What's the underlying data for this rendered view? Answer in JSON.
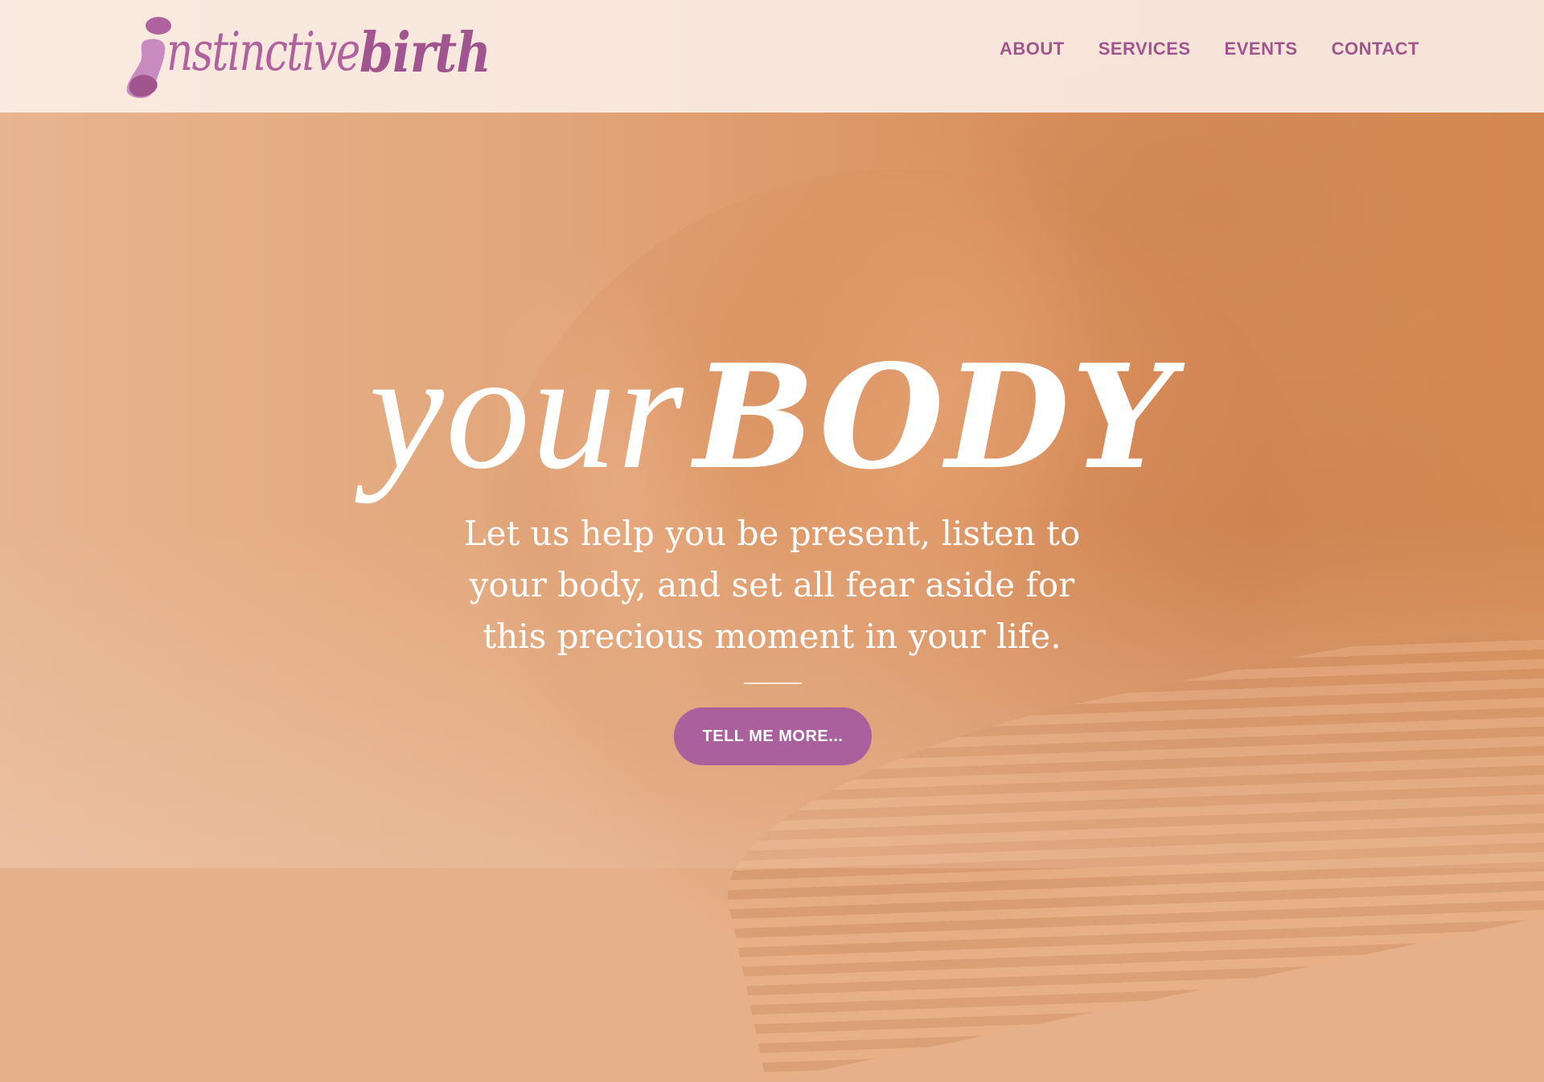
{
  "brand": {
    "logo_light": "nstinctive",
    "logo_bold": "birth",
    "colors": {
      "primary": "#a1558f",
      "button": "#a9609c",
      "header_bg": "#fcf0ea",
      "hero_tint": "#d88e5c"
    }
  },
  "nav": {
    "items": [
      {
        "label": "ABOUT"
      },
      {
        "label": "SERVICES"
      },
      {
        "label": "EVENTS"
      },
      {
        "label": "CONTACT"
      }
    ]
  },
  "hero": {
    "headline_light": "your",
    "headline_bold": "BODY",
    "subtext_lines": [
      "Let us help you be present, listen to",
      "your body, and set all fear aside for",
      "this precious moment in your life."
    ],
    "cta_label": "TELL ME MORE..."
  },
  "icons": {
    "logo_mark": "stylized-letter-i-icon"
  }
}
